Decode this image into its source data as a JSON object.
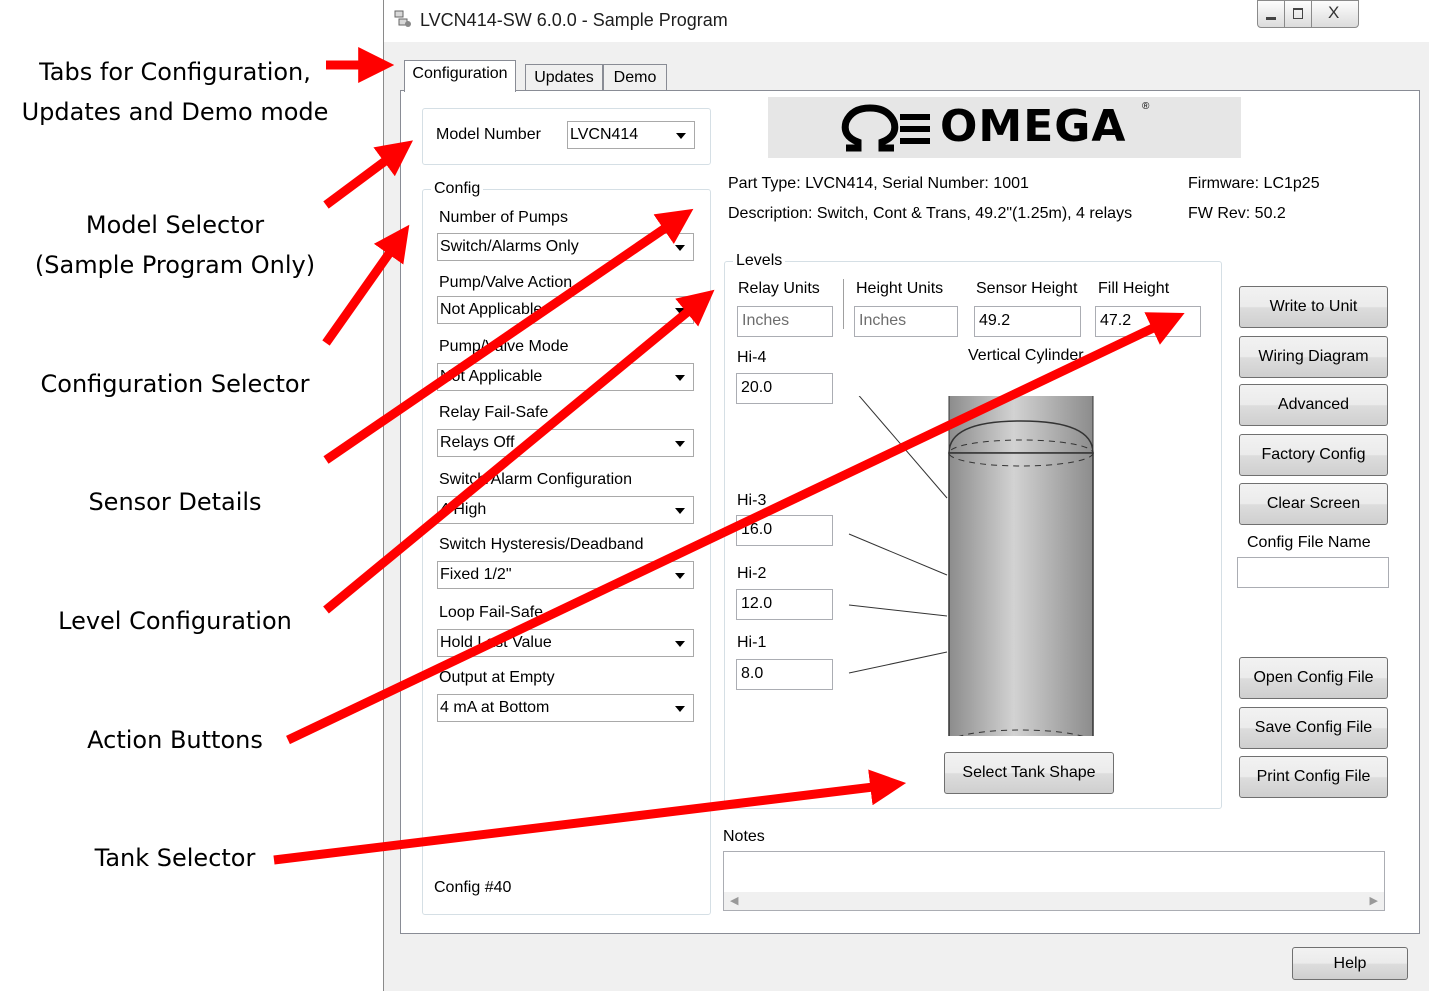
{
  "annotations": {
    "tabs": "Tabs for Configuration,\nUpdates and Demo mode",
    "model_selector": "Model Selector\n(Sample Program Only)",
    "config_selector": "Configuration Selector",
    "sensor_details": "Sensor Details",
    "level_config": "Level  Configuration",
    "action_buttons": "Action Buttons",
    "tank_selector": "Tank Selector"
  },
  "window": {
    "title": "LVCN414-SW 6.0.0 - Sample Program"
  },
  "tabs": [
    "Configuration",
    "Updates",
    "Demo"
  ],
  "model": {
    "label": "Model Number",
    "value": "LVCN414"
  },
  "logo": "OMEGA",
  "config": {
    "legend": "Config",
    "fields": [
      {
        "label": "Number of Pumps",
        "value": "Switch/Alarms Only"
      },
      {
        "label": "Pump/Valve Action",
        "value": "Not Applicable"
      },
      {
        "label": "Pump/Valve Mode",
        "value": "Not Applicable"
      },
      {
        "label": "Relay Fail-Safe",
        "value": "Relays Off"
      },
      {
        "label": "Switch/Alarm Configuration",
        "value": "4 High"
      },
      {
        "label": "Switch Hysteresis/Deadband",
        "value": "Fixed 1/2\""
      },
      {
        "label": "Loop Fail-Safe",
        "value": "Hold Last Value"
      },
      {
        "label": "Output at Empty",
        "value": "4 mA at Bottom"
      }
    ],
    "config_number": "Config #40"
  },
  "sensor": {
    "part": "Part Type: LVCN414, Serial Number: 1001",
    "description": "Description: Switch, Cont & Trans, 49.2\"(1.25m), 4 relays",
    "firmware": "Firmware: LC1p25",
    "fw_rev": "FW Rev:  50.2"
  },
  "levels": {
    "legend": "Levels",
    "relay_units_label": "Relay Units",
    "relay_units": "Inches",
    "height_units_label": "Height Units",
    "height_units": "Inches",
    "sensor_height_label": "Sensor Height",
    "sensor_height": "49.2",
    "fill_height_label": "Fill Height",
    "fill_height": "47.2",
    "tank_type": "Vertical Cylinder",
    "hi4_label": "Hi-4",
    "hi4": "20.0",
    "hi3_label": "Hi-3",
    "hi3": "16.0",
    "hi2_label": "Hi-2",
    "hi2": "12.0",
    "hi1_label": "Hi-1",
    "hi1": "8.0",
    "select_tank": "Select Tank Shape"
  },
  "actions": {
    "write": "Write to Unit",
    "wiring": "Wiring Diagram",
    "advanced": "Advanced",
    "factory": "Factory Config",
    "clear": "Clear Screen",
    "file_name_label": "Config File Name",
    "file_name": "",
    "open": "Open Config File",
    "save": "Save Config File",
    "print": "Print Config File"
  },
  "notes": {
    "label": "Notes",
    "value": ""
  },
  "help": "Help",
  "colors": {
    "arrow": "#ff0000",
    "window_bg": "#f0f0f0",
    "logo_bg": "#e6e6e6"
  }
}
